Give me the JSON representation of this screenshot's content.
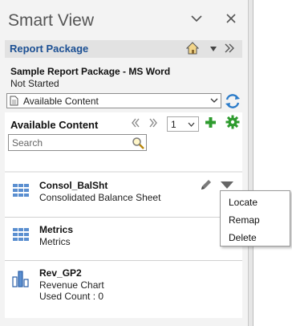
{
  "pane": {
    "title": "Smart View"
  },
  "report_package": {
    "label": "Report Package",
    "name": "Sample Report Package - MS Word",
    "status": "Not Started"
  },
  "content_select": {
    "selected": "Available Content"
  },
  "available_content": {
    "heading": "Available Content",
    "page": "1",
    "search_placeholder": "Search",
    "items": [
      {
        "name": "Consol_BalSht",
        "description": "Consolidated Balance Sheet",
        "extra": "",
        "icon": "grid-icon"
      },
      {
        "name": "Metrics",
        "description": "Metrics",
        "extra": "",
        "icon": "grid-icon"
      },
      {
        "name": "Rev_GP2",
        "description": "Revenue Chart",
        "extra": "Used Count : 0",
        "icon": "bar-chart-icon"
      }
    ]
  },
  "context_menu": {
    "items": [
      "Locate",
      "Remap",
      "Delete"
    ]
  },
  "colors": {
    "link_blue": "#1b4f93",
    "add_green": "#2e9b2e",
    "grid_blue": "#5b8fd0"
  }
}
